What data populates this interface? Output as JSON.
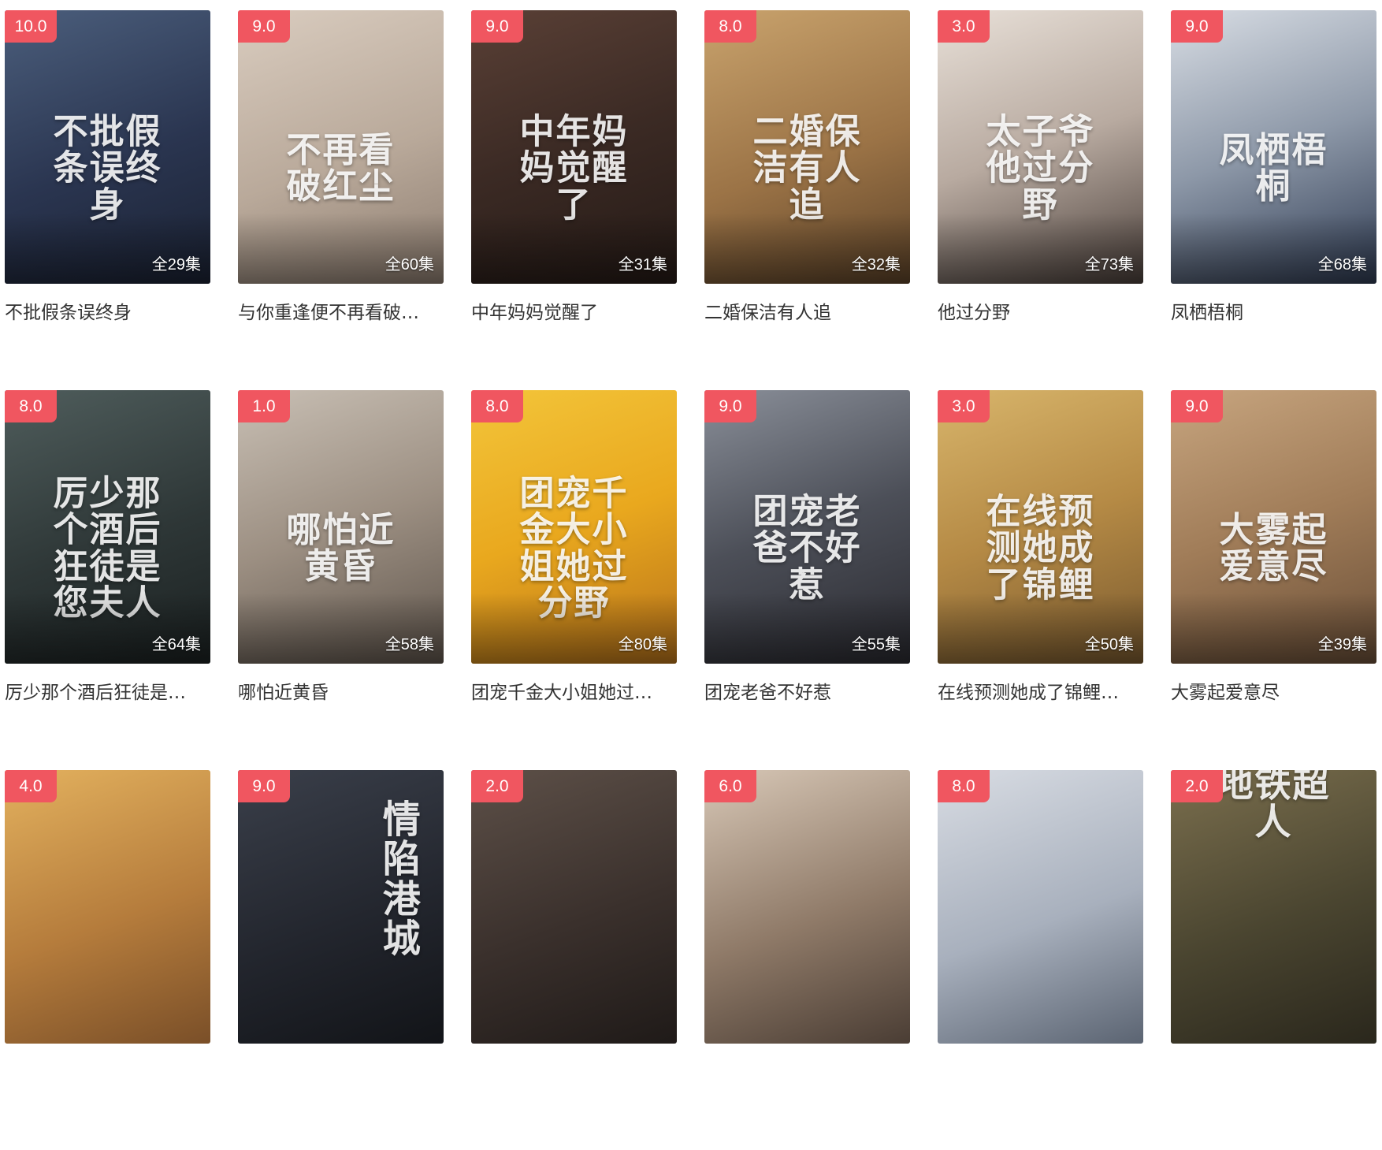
{
  "colors": {
    "score_badge": "#f05660",
    "title_text": "#333333"
  },
  "dramas": [
    {
      "score": "10.0",
      "episodes": "全29集",
      "title": "不批假条误终身",
      "poster_text": "不批假条误终身",
      "bg": "linear-gradient(160deg,#4b5e7c 0%,#2a3550 55%,#1b2233 100%)"
    },
    {
      "score": "9.0",
      "episodes": "全60集",
      "title": "与你重逢便不再看破…",
      "poster_text": "不再看破红尘",
      "bg": "linear-gradient(160deg,#d9ccbf 0%,#b9a99a 55%,#8d7d70 100%)"
    },
    {
      "score": "9.0",
      "episodes": "全31集",
      "title": "中年妈妈觉醒了",
      "poster_text": "中年妈妈觉醒了",
      "bg": "linear-gradient(160deg,#5a4036 0%,#3b2a24 50%,#251a16 100%)"
    },
    {
      "score": "8.0",
      "episodes": "全32集",
      "title": "二婚保洁有人追",
      "poster_text": "二婚保洁有人追",
      "bg": "linear-gradient(160deg,#c9a36d 0%,#9b7346 55%,#5c4228 100%)"
    },
    {
      "score": "3.0",
      "episodes": "全73集",
      "title": "他过分野",
      "poster_text": "太子爷他过分野",
      "bg": "linear-gradient(160deg,#e8e0d8 0%,#b8aaa0 50%,#4a3f3a 100%)"
    },
    {
      "score": "9.0",
      "episodes": "全68集",
      "title": "凤栖梧桐",
      "poster_text": "凤栖梧桐",
      "bg": "linear-gradient(160deg,#d8dde4 0%,#8d98a8 50%,#2f3b52 100%)"
    },
    {
      "score": "8.0",
      "episodes": "全64集",
      "title": "厉少那个酒后狂徒是…",
      "poster_text": "厉少那个酒后狂徒是您夫人",
      "bg": "linear-gradient(160deg,#4f5d5c 0%,#2e3737 55%,#1b2121 100%)"
    },
    {
      "score": "1.0",
      "episodes": "全58集",
      "title": "哪怕近黄昏",
      "poster_text": "哪怕近黄昏",
      "bg": "linear-gradient(160deg,#c8bfb4 0%,#9c8f82 50%,#5f554c 100%)"
    },
    {
      "score": "8.0",
      "episodes": "全80集",
      "title": "团宠千金大小姐她过…",
      "poster_text": "团宠千金大小姐她过分野",
      "bg": "linear-gradient(160deg,#f3c53a 0%,#e9a81e 50%,#b7721a 100%)"
    },
    {
      "score": "9.0",
      "episodes": "全55集",
      "title": "团宠老爸不好惹",
      "poster_text": "团宠老爸不好惹",
      "bg": "linear-gradient(160deg,#8a8f99 0%,#4c4f58 50%,#2a2a30 100%)"
    },
    {
      "score": "3.0",
      "episodes": "全50集",
      "title": "在线预测她成了锦鲤…",
      "poster_text": "在线预测她成了锦鲤",
      "bg": "linear-gradient(160deg,#d8b56b 0%,#b58a45 50%,#7a5a2f 100%)"
    },
    {
      "score": "9.0",
      "episodes": "全39集",
      "title": "大雾起爱意尽",
      "poster_text": "大雾起爱意尽",
      "bg": "linear-gradient(160deg,#c7a57f 0%,#a07c58 50%,#6a4f38 100%)"
    },
    {
      "score": "4.0",
      "episodes": "",
      "title": "",
      "poster_text": "",
      "bg": "linear-gradient(160deg,#e3b15e 0%,#b57c3c 55%,#7a4f28 100%)"
    },
    {
      "score": "9.0",
      "episodes": "",
      "title": "",
      "poster_text": "情陷港城",
      "bg": "linear-gradient(160deg,#3a3f4a 0%,#23262e 55%,#121418 100%)"
    },
    {
      "score": "2.0",
      "episodes": "",
      "title": "",
      "poster_text": "",
      "bg": "linear-gradient(160deg,#5d5048 0%,#3a302c 55%,#1f1a18 100%)"
    },
    {
      "score": "6.0",
      "episodes": "",
      "title": "",
      "poster_text": "",
      "bg": "linear-gradient(160deg,#d7c7b6 0%,#8f7a68 55%,#4a3d34 100%)"
    },
    {
      "score": "8.0",
      "episodes": "",
      "title": "",
      "poster_text": "",
      "bg": "linear-gradient(160deg,#d8dce3 0%,#a8b0bd 55%,#5b6472 100%)"
    },
    {
      "score": "2.0",
      "episodes": "",
      "title": "",
      "poster_text": "地铁超人",
      "bg": "linear-gradient(160deg,#7b6f4e 0%,#4a4530 55%,#2a271c 100%)"
    }
  ]
}
